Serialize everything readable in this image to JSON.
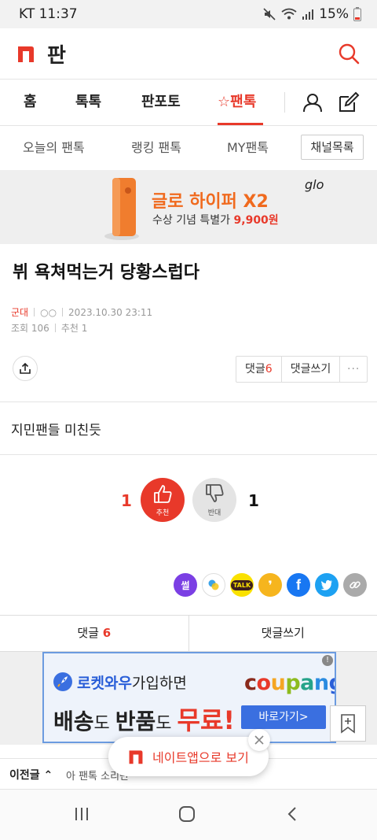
{
  "status_bar": {
    "carrier_time": "KT 11:37",
    "battery": "15%"
  },
  "header": {
    "title": "판"
  },
  "main_nav": {
    "home": "홈",
    "toktok": "톡톡",
    "panphoto": "판포토",
    "pantok": "☆팬톡"
  },
  "sub_nav": {
    "today": "오늘의 팬톡",
    "ranking": "랭킹 팬톡",
    "my": "MY팬톡",
    "channel_list": "채널목록"
  },
  "banner": {
    "title": "글로 하이퍼 X2",
    "subtitle": "수상 기념 특별가 ",
    "price": "9,900원",
    "brand": "glo"
  },
  "post": {
    "title": "뷔 욕쳐먹는거 당황스럽다",
    "category": "군대",
    "author": "○○",
    "date": "2023.10.30 23:11",
    "views": "조회 106",
    "recommend": "추천 1",
    "body": "지민팬들 미친듯"
  },
  "actions": {
    "comments_label": "댓글",
    "comments_count": "6",
    "write_comment": "댓글쓰기",
    "more": "···"
  },
  "vote": {
    "up_count": "1",
    "up_label": "추천",
    "down_label": "반대",
    "down_count": "1"
  },
  "sns": {
    "ssul": "썰",
    "talk": "TALK"
  },
  "comment_bar": {
    "comments_label": "댓글 ",
    "comments_count": "6",
    "write_comment": "댓글쓰기"
  },
  "ad": {
    "line1_brand": "로켓와우",
    "line1_rest": "가입하면",
    "logo": "coupang",
    "line2_a": "배송",
    "line2_b": "도 ",
    "line2_c": "반품",
    "line2_d": "도 ",
    "line2_e": "무료!",
    "button": "바로가기>"
  },
  "prev_post": {
    "label": "이전글 ⌃",
    "title": "아 팬톡 소리만"
  },
  "floating": {
    "app_text": "네이트앱으로 보기"
  },
  "colors": {
    "accent": "#e8392a",
    "coupang_blue": "#3a6fe0"
  }
}
